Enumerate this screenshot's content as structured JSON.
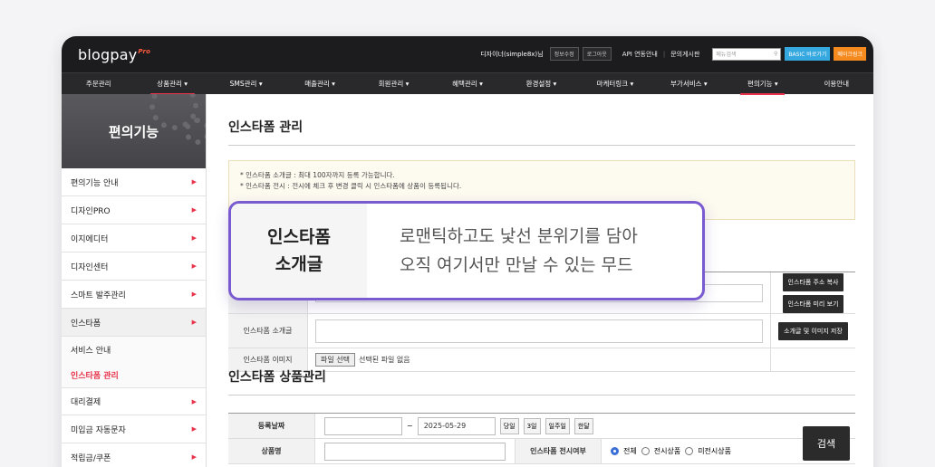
{
  "header": {
    "logo_main": "blogpay",
    "logo_sup": "Pro",
    "user": "디자이너(simple8x)님",
    "info_edit": "정보수정",
    "logout": "로그아웃",
    "api_guide": "API 연동안내",
    "board": "문의게시판",
    "search_placeholder": "메뉴검색",
    "basic_btn": "BASIC 바로가기",
    "mycheck_btn": "메이크링크"
  },
  "nav": [
    "주문관리",
    "상품관리 ▾",
    "SMS관리 ▾",
    "매출관리 ▾",
    "회원관리 ▾",
    "혜택관리 ▾",
    "환경설정 ▾",
    "마케터링크 ▾",
    "부가서비스 ▾",
    "편의기능 ▾",
    "이용안내"
  ],
  "sidebar": {
    "title": "편의기능",
    "items": [
      {
        "label": "편의기능 안내"
      },
      {
        "label": "디자인PRO"
      },
      {
        "label": "이지에디터"
      },
      {
        "label": "디자인센터"
      },
      {
        "label": "스마트 발주관리"
      },
      {
        "label": "인스타폼"
      }
    ],
    "sub_items": [
      {
        "label": "서비스 안내"
      },
      {
        "label": "인스타폼 관리"
      }
    ],
    "items_after": [
      {
        "label": "대리결제"
      },
      {
        "label": "미입금 자동문자"
      },
      {
        "label": "적립금/쿠폰"
      }
    ]
  },
  "main": {
    "title": "인스타폼 관리",
    "notice_lines": [
      "* 인스타폼 소개글 : 최대 100자까지 등록 가능합니다.",
      "* 인스타폼 전시 : 전시에 체크 후 변경 클릭 시 인스타폼에 상품이 등록됩니다."
    ],
    "buttons": {
      "copy_addr": "인스타폼 주소 복사",
      "preview": "인스타폼 미리 보기",
      "save": "소개글 및 이미지 저장"
    },
    "intro_label": "인스타폼 소개글",
    "image_label": "인스타폼 이미지",
    "file_btn": "파일 선택",
    "file_none": "선택된 파일 없음",
    "product_title": "인스타폼 상품관리",
    "search": {
      "date_label": "등록날짜",
      "date_sep": "~",
      "date_to": "2025-05-29",
      "chips": [
        "당일",
        "3일",
        "일주일",
        "한달"
      ],
      "name_label": "상품명",
      "display_label": "인스타폼 전시여부",
      "radio_all": "전체",
      "radio_on": "전시상품",
      "radio_off": "미전시상품",
      "search_btn": "검색"
    }
  },
  "callout": {
    "label_line1": "인스타폼",
    "label_line2": "소개글",
    "text_line1": "로맨틱하고도 낯선 분위기를 담아",
    "text_line2": "오직 여기서만 만날 수 있는 무드"
  }
}
